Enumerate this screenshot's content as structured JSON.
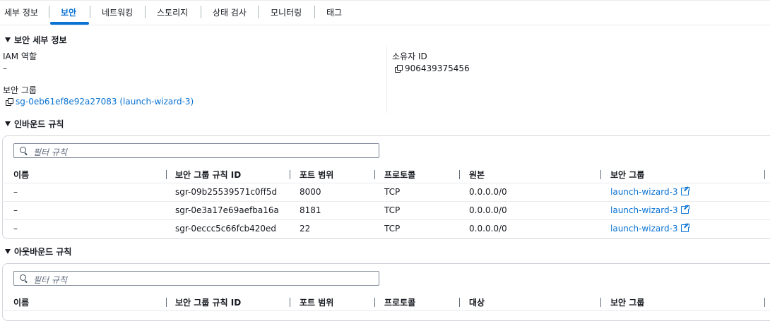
{
  "tabs": [
    {
      "label": "세부 정보",
      "active": false
    },
    {
      "label": "보안",
      "active": true
    },
    {
      "label": "네트워킹",
      "active": false
    },
    {
      "label": "스토리지",
      "active": false
    },
    {
      "label": "상태 검사",
      "active": false
    },
    {
      "label": "모니터링",
      "active": false
    },
    {
      "label": "태그",
      "active": false
    }
  ],
  "security_details": {
    "heading": "보안 세부 정보",
    "iam_role_label": "IAM 역할",
    "iam_role_value": "–",
    "owner_id_label": "소유자 ID",
    "owner_id_value": "906439375456",
    "security_groups_label": "보안 그룹",
    "security_groups_value": "sg-0eb61ef8e92a27083 (launch-wizard-3)"
  },
  "inbound": {
    "heading": "인바운드 규칙",
    "filter_placeholder": "필터 규칙",
    "columns": [
      "이름",
      "보안 그룹 규칙 ID",
      "포트 범위",
      "프로토콜",
      "원본",
      "보안 그룹"
    ],
    "rows": [
      {
        "name": "–",
        "rule_id": "sgr-09b25539571c0ff5d",
        "port": "8000",
        "protocol": "TCP",
        "source": "0.0.0.0/0",
        "sg": "launch-wizard-3"
      },
      {
        "name": "–",
        "rule_id": "sgr-0e3a17e69aefba16a",
        "port": "8181",
        "protocol": "TCP",
        "source": "0.0.0.0/0",
        "sg": "launch-wizard-3"
      },
      {
        "name": "–",
        "rule_id": "sgr-0eccc5c66fcb420ed",
        "port": "22",
        "protocol": "TCP",
        "source": "0.0.0.0/0",
        "sg": "launch-wizard-3"
      }
    ]
  },
  "outbound": {
    "heading": "아웃바운드 규칙",
    "filter_placeholder": "필터 규칙",
    "columns": [
      "이름",
      "보안 그룹 규칙 ID",
      "포트 범위",
      "프로토콜",
      "대상",
      "보안 그룹"
    ]
  },
  "colors": {
    "accent": "#0972d3",
    "text": "#16191f",
    "border": "#e9ebed"
  }
}
